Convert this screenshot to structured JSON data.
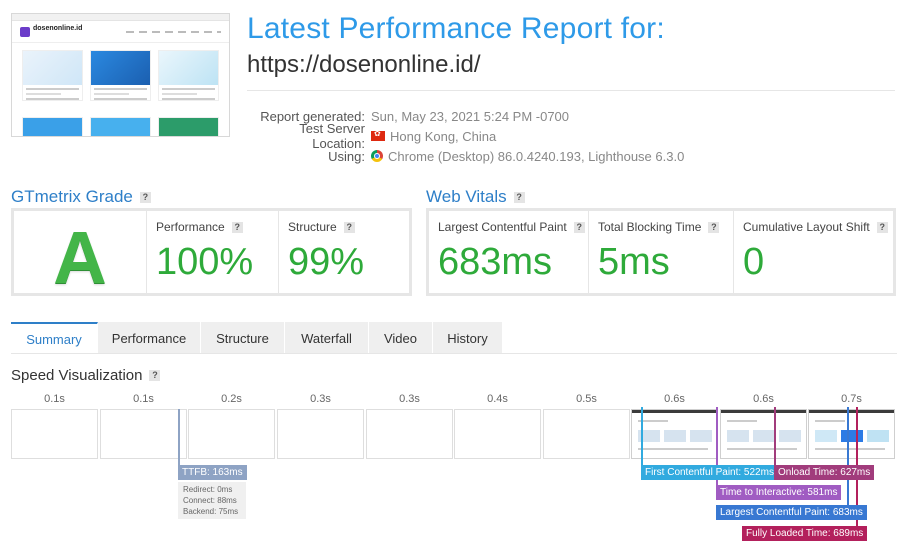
{
  "report": {
    "title": "Latest Performance Report for:",
    "url": "https://dosenonline.id/",
    "meta": [
      {
        "label": "Report generated:",
        "value": "Sun, May 23, 2021 5:24 PM -0700",
        "icon": ""
      },
      {
        "label": "Test Server Location:",
        "value": "Hong Kong, China",
        "icon": "hong-kong-flag-icon"
      },
      {
        "label": "Using:",
        "value": "Chrome (Desktop) 86.0.4240.193, Lighthouse 6.3.0",
        "icon": "chrome-icon"
      }
    ]
  },
  "screenshot": {
    "site_name": "dosenonline.id"
  },
  "gtmetrix": {
    "heading": "GTmetrix Grade",
    "grade": "A",
    "performance_label": "Performance",
    "performance_value": "100%",
    "structure_label": "Structure",
    "structure_value": "99%"
  },
  "web_vitals": {
    "heading": "Web Vitals",
    "lcp_label": "Largest Contentful Paint",
    "lcp_value": "683ms",
    "tbt_label": "Total Blocking Time",
    "tbt_value": "5ms",
    "cls_label": "Cumulative Layout Shift",
    "cls_value": "0"
  },
  "tabs": [
    "Summary",
    "Performance",
    "Structure",
    "Waterfall",
    "Video",
    "History"
  ],
  "active_tab": "Summary",
  "speed": {
    "heading": "Speed Visualization",
    "frame_labels": [
      "0.1s",
      "0.1s",
      "0.2s",
      "0.3s",
      "0.3s",
      "0.4s",
      "0.5s",
      "0.6s",
      "0.6s",
      "0.7s"
    ],
    "ttfb_label": "TTFB: 163ms",
    "ttfb_details": [
      "Redirect: 0ms",
      "Connect: 88ms",
      "Backend: 75ms"
    ],
    "markers": {
      "fcp": "First Contentful Paint: 522ms",
      "onload": "Onload Time: 627ms",
      "tti": "Time to Interactive: 581ms",
      "lcp": "Largest Contentful Paint: 683ms",
      "fully_loaded": "Fully Loaded Time: 689ms"
    }
  },
  "colors": {
    "accent": "#2e9ae8",
    "grade_green": "#43b548",
    "value_green": "#2eaa3a",
    "ttfb": "#8ea3c4",
    "fcp": "#31aadf",
    "tti": "#a05cc2",
    "onload": "#a13c7c",
    "lcp": "#3878d2",
    "fully_loaded": "#b3205c"
  }
}
